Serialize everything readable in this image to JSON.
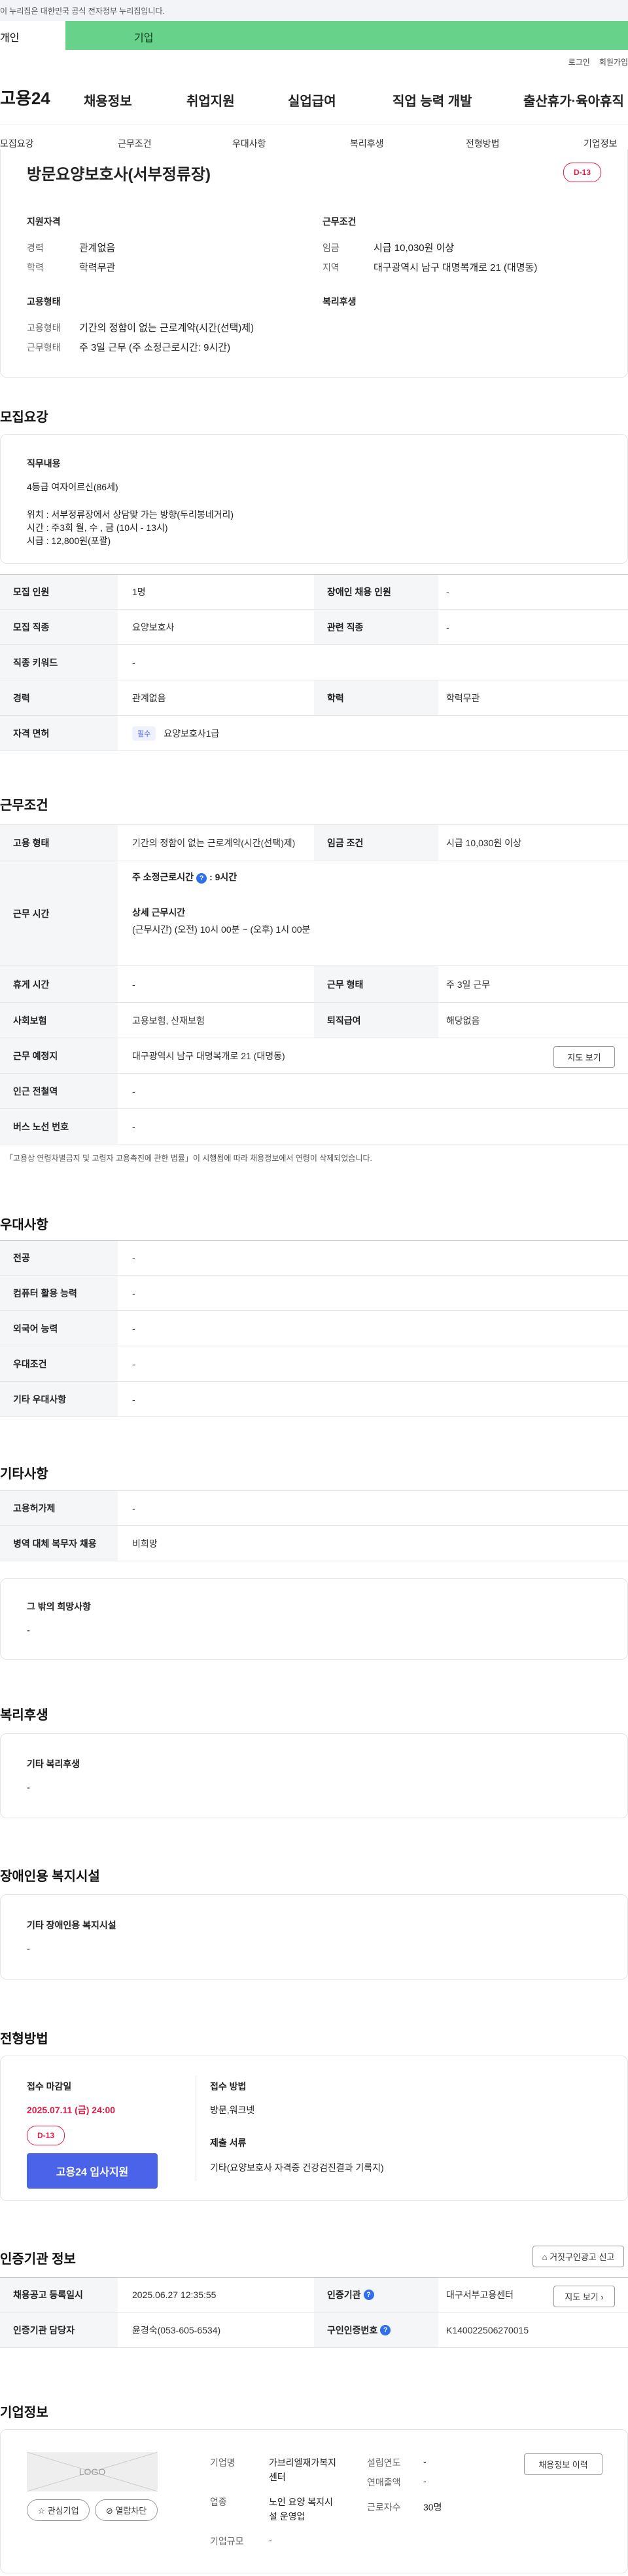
{
  "gov_banner": "이 누리집은 대한민국 공식 전자정부 누리집입니다.",
  "user_tabs": [
    "개인",
    "기업"
  ],
  "top_links": [
    "로그인",
    "회원가입"
  ],
  "logo": "고용24",
  "gnb": [
    "채용정보",
    "취업지원",
    "실업급여",
    "직업 능력 개발",
    "출산휴가·육아휴직"
  ],
  "subnav": [
    "모집요강",
    "근무조건",
    "우대사항",
    "복리후생",
    "전형방법",
    "기업정보"
  ],
  "job": {
    "title": "방문요양보호사(서부정류장)",
    "dday": "D-13",
    "qual_title": "지원자격",
    "career_k": "경력",
    "career_v": "관계없음",
    "edu_k": "학력",
    "edu_v": "학력무관",
    "cond_title": "근무조건",
    "wage_k": "임금",
    "wage_v": "시급 10,030원 이상",
    "area_k": "지역",
    "area_v": "대구광역시 남구 대명복개로 21 (대명동)",
    "emp_title": "고용형태",
    "emp_k": "고용형태",
    "emp_v": "기간의 정함이 없는 근로계약(시간(선택)제)",
    "work_k": "근무형태",
    "work_v": "주 3일 근무 (주 소정근로시간: 9시간)",
    "welfare_title": "복리후생"
  },
  "recruit": {
    "title": "모집요강",
    "duty_title": "직무내용",
    "duty_lines": [
      "4등급 여자어르신(86세)",
      "",
      "위치 : 서부정류장에서 상담맞 가는 방향(두리봉네거리)",
      "시간 : 주3회  월, 수 , 금 (10시 - 13시)",
      "시급 : 12,800원(포괄)"
    ],
    "rows": [
      {
        "k": "모집 인원",
        "v": "1명",
        "k2": "장애인 채용 인원",
        "v2": "-"
      },
      {
        "k": "모집 직종",
        "v": "요양보호사",
        "k2": "관련 직종",
        "v2": "-"
      },
      {
        "k": "직종 키워드",
        "v": "-"
      },
      {
        "k": "경력",
        "v": "관계없음",
        "k2": "학력",
        "v2": "학력무관"
      },
      {
        "k": "자격 면허",
        "badge": "필수",
        "v": "요양보호사1급"
      }
    ]
  },
  "work": {
    "title": "근무조건",
    "type_k": "고용 형태",
    "type_v": "기간의 정함이 없는 근로계약(시간(선택)제)",
    "wage_k": "임금 조건",
    "wage_v": "시급 10,030원 이상",
    "time_k": "근무 시간",
    "weekly": "주 소정근로시간",
    "weekly_v": ": 9시간",
    "detail_title": "상세 근무시간",
    "detail_v": "(근무시간) (오전) 10시 00분 ~ (오후) 1시 00분",
    "rest_k": "휴게 시간",
    "rest_v": "-",
    "form_k": "근무 형태",
    "form_v": "주 3일 근무",
    "ins_k": "사회보험",
    "ins_v": "고용보험, 산재보험",
    "retire_k": "퇴직급여",
    "retire_v": "해당없음",
    "place_k": "근무 예정지",
    "place_v": "대구광역시 남구 대명복개로 21 (대명동)",
    "map_btn": "지도 보기",
    "subway_k": "인근 전철역",
    "subway_v": "-",
    "bus_k": "버스 노선 번호",
    "bus_v": "-",
    "note": "「고용상 연령차별금지 및 고령자 고용촉진에 관한 법률」이 시행됨에 따라 채용정보에서 연령이 삭제되었습니다."
  },
  "pref": {
    "title": "우대사항",
    "rows": [
      {
        "k": "전공",
        "v": "-"
      },
      {
        "k": "컴퓨터 활용 능력",
        "v": "-"
      },
      {
        "k": "외국어 능력",
        "v": "-"
      },
      {
        "k": "우대조건",
        "v": "-"
      },
      {
        "k": "기타 우대사항",
        "v": "-"
      }
    ]
  },
  "etc": {
    "title": "기타사항",
    "rows": [
      {
        "k": "고용허가제",
        "v": "-"
      },
      {
        "k": "병역 대체 복무자 채용",
        "v": "비희망"
      }
    ],
    "other_title": "그 밖의 희망사항",
    "other_v": "-"
  },
  "welfare": {
    "title": "복리후생",
    "box_title": "기타 복리후생",
    "box_v": "-"
  },
  "disab": {
    "title": "장애인용 복지시설",
    "box_title": "기타 장애인용 복지시설",
    "box_v": "-"
  },
  "select": {
    "title": "전형방법",
    "deadline_title": "접수 마감일",
    "deadline": "2025.07.11 (금) 24:00",
    "dday": "D-13",
    "apply_btn": "고용24 입사지원",
    "method_title": "접수 방법",
    "method_v": "방문,워크넷",
    "docs_title": "제출 서류",
    "docs_v": "기타(요양보호사 자격증 건강검진결과 기록지)"
  },
  "cert": {
    "title": "인증기관 정보",
    "report_btn": "거짓구인광고 신고",
    "reg_k": "채용공고 등록일시",
    "reg_v": "2025.06.27 12:35:55",
    "org_k": "인증기관",
    "org_v": "대구서부고용센터",
    "view_btn": "지도 보기",
    "mgr_k": "인증기관 담당자",
    "mgr_v": "윤경숙(053-605-6534)",
    "num_k": "구인인증번호",
    "num_v": "K140022506270015"
  },
  "company": {
    "title": "기업정보",
    "logo": "LOGO",
    "fav_btn": "관심기업",
    "block_btn": "열람차단",
    "info_btn": "채용정보 이력",
    "name_k": "기업명",
    "name_v1": "가브리엘재가복지",
    "name_v2": "센터",
    "ind_k": "업종",
    "ind_v1": "노인 요양 복지시",
    "ind_v2": "설 운영업",
    "size_k": "기업규모",
    "size_v": "-",
    "year_k": "설립연도",
    "year_v": "-",
    "sales_k": "연매출액",
    "sales_v": "-",
    "emp_k": "근로자수",
    "emp_v": "30명"
  }
}
